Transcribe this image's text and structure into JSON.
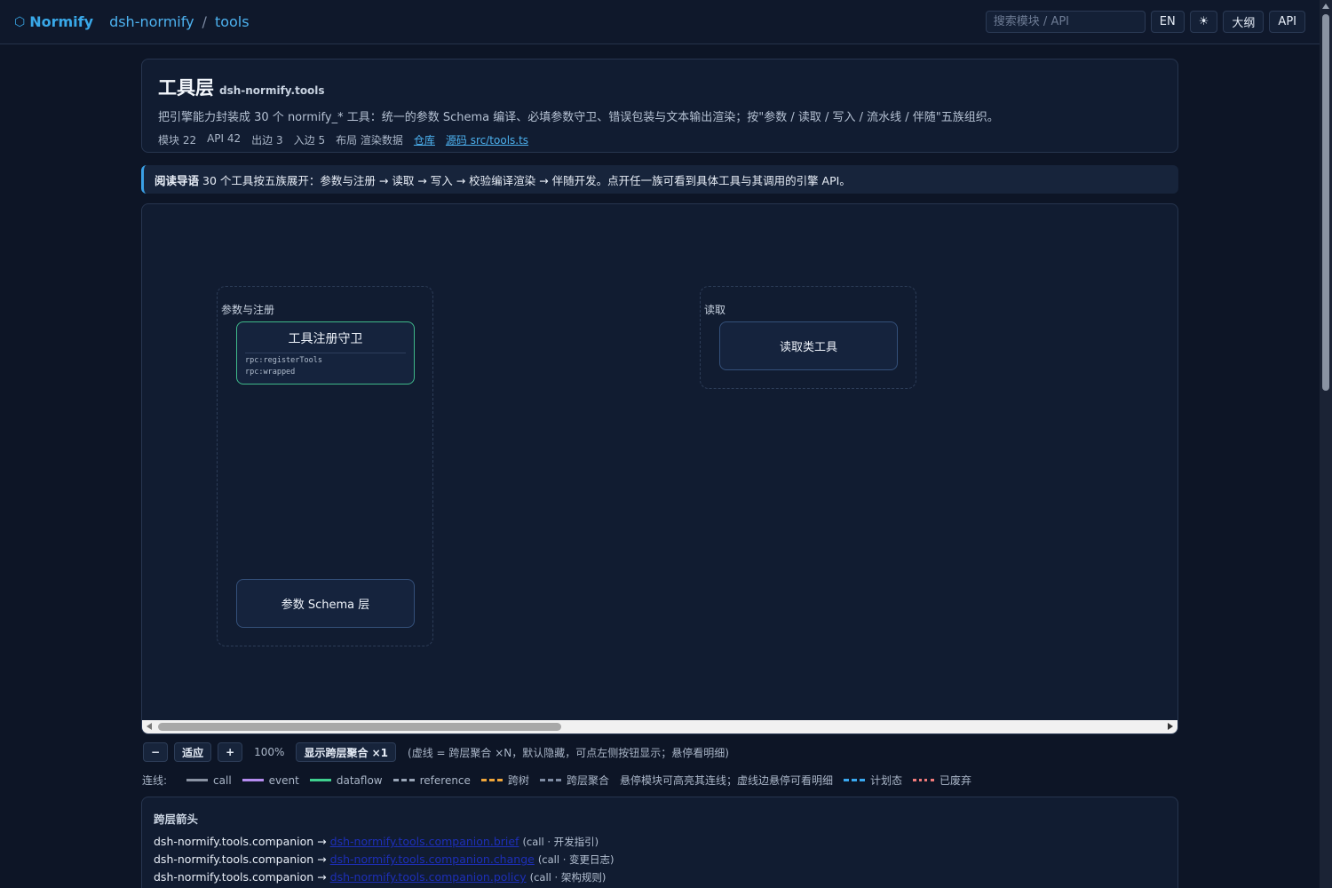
{
  "topbar": {
    "brand": "Normify",
    "crumbs": [
      "dsh-normify",
      "tools"
    ],
    "crumb_sep": "/",
    "search_placeholder": "搜索模块 / API",
    "lang_btn": "EN",
    "theme_icon": "☀",
    "outline_btn": "大纲",
    "api_btn": "API"
  },
  "header": {
    "title": "工具层",
    "package": "dsh-normify.tools",
    "description": "把引擎能力封装成 30 个 normify_* 工具：统一的参数 Schema 编译、必填参数守卫、错误包装与文本输出渲染；按\"参数 / 读取 / 写入 / 流水线 / 伴随\"五族组织。",
    "meta": {
      "modules": "模块 22",
      "api": "API 42",
      "out_edges": "出边 3",
      "in_edges": "入边 5",
      "layout": "布局 渲染数据",
      "repo_link": "仓库",
      "source_link": "源码 src/tools.ts"
    }
  },
  "guide": {
    "label": "阅读导语",
    "text": "30 个工具按五族展开：参数与注册 → 读取 → 写入 → 校验编译渲染 → 伴随开发。点开任一族可看到具体工具与其调用的引擎 API。"
  },
  "diagram": {
    "groups": [
      {
        "label": "参数与注册",
        "nodes": [
          {
            "title": "工具注册守卫",
            "apis": [
              "rpc:registerTools",
              "rpc:wrapped"
            ]
          },
          {
            "title": "参数 Schema 层"
          }
        ]
      },
      {
        "label": "读取",
        "nodes": [
          {
            "title": "读取类工具"
          }
        ]
      }
    ]
  },
  "controls": {
    "minus": "−",
    "fit": "适应",
    "plus": "+",
    "zoom": "100%",
    "toggle_cross": "显示跨层聚合 ×1",
    "hint": "(虚线 = 跨层聚合 ×N，默认隐藏，可点左侧按钮显示；悬停看明细)"
  },
  "legend": {
    "label": "连线:",
    "items": [
      {
        "name": "call",
        "color": "#8a93a3",
        "style": "solid"
      },
      {
        "name": "event",
        "color": "#b58cf0",
        "style": "solid"
      },
      {
        "name": "dataflow",
        "color": "#3fd08e",
        "style": "solid"
      },
      {
        "name": "reference",
        "color": "#9aa6b8",
        "style": "dashed"
      },
      {
        "name": "跨树",
        "color": "#f0a63a",
        "style": "dashed"
      },
      {
        "name": "跨层聚合",
        "color": "#7f8ca3",
        "style": "dashed"
      }
    ],
    "note": "悬停模块可高亮其连线；虚线边悬停可看明细",
    "items2": [
      {
        "name": "计划态",
        "color": "#3aa8f0",
        "style": "dashed"
      },
      {
        "name": "已废弃",
        "color": "#f07a7a",
        "style": "dotted"
      }
    ]
  },
  "cross_arrows": {
    "title": "跨层箭头",
    "rows": [
      {
        "from": "dsh-normify.tools.companion →",
        "to": "dsh-normify.tools.companion.brief",
        "note": "(call · 开发指引)"
      },
      {
        "from": "dsh-normify.tools.companion →",
        "to": "dsh-normify.tools.companion.change",
        "note": "(call · 变更日志)"
      },
      {
        "from": "dsh-normify.tools.companion →",
        "to": "dsh-normify.tools.companion.policy",
        "note": "(call · 架构规则)"
      }
    ]
  }
}
